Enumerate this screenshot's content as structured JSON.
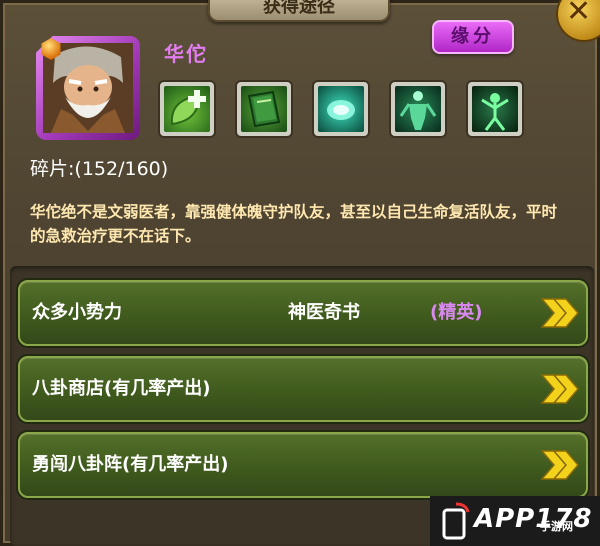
{
  "header": {
    "title": "获得途径",
    "close_symbol": "✕"
  },
  "hero": {
    "name": "华佗",
    "fate_button": "缘分",
    "fragments_label": "碎片:",
    "fragments_value": "(152/160)",
    "description": "华佗绝不是文弱医者，靠强健体魄守护队友，甚至以自己生命复活队友，平时的急救治疗更不在话下。"
  },
  "skills": [
    {
      "icon": "healing-leaf-icon"
    },
    {
      "icon": "medical-book-icon"
    },
    {
      "icon": "green-aura-icon"
    },
    {
      "icon": "body-silhouette-icon"
    },
    {
      "icon": "figure-burst-icon"
    }
  ],
  "sources": [
    {
      "label": "众多小势力",
      "item": "神医奇书",
      "tag": "(精英)"
    },
    {
      "label": "八卦商店(有几率产出)",
      "item": "",
      "tag": ""
    },
    {
      "label": "勇闯八卦阵(有几率产出)",
      "item": "",
      "tag": ""
    }
  ],
  "watermark": {
    "brand": "APP178",
    "sub": "手游网"
  },
  "colors": {
    "row_green": "#4a6824",
    "arrow_yellow": "#f3d21c",
    "hero_name": "#e27cf0",
    "fate_purple": "#c43bd9"
  }
}
